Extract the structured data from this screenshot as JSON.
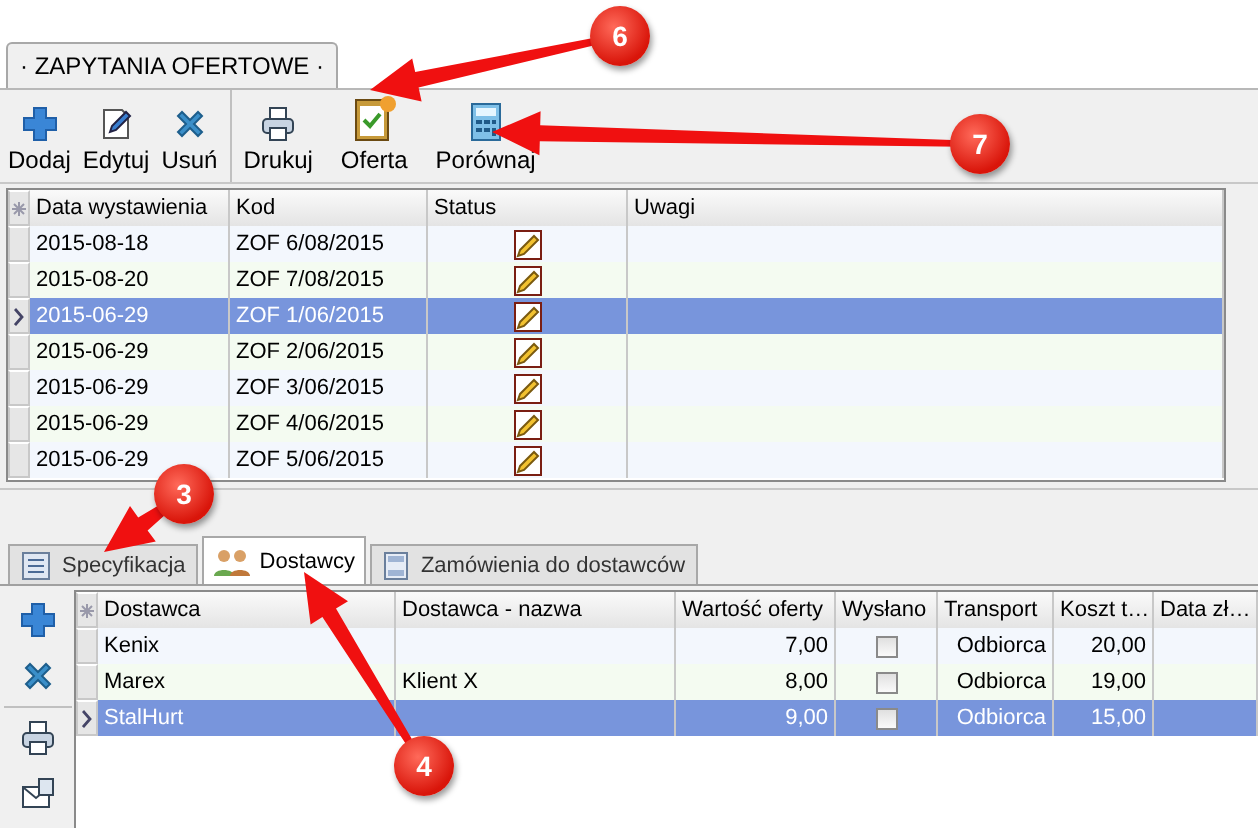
{
  "main_tab": {
    "label": "· ZAPYTANIA OFERTOWE ·"
  },
  "toolbar": {
    "groups": [
      [
        "Dodaj",
        "Edytuj",
        "Usuń"
      ],
      [
        "Drukuj",
        "Oferta",
        "Porównaj"
      ]
    ]
  },
  "offers_table": {
    "columns": [
      "Data wystawienia",
      "Kod",
      "Status",
      "Uwagi"
    ],
    "rows": [
      {
        "date": "2015-08-18",
        "code": "ZOF 6/08/2015",
        "selected": false
      },
      {
        "date": "2015-08-20",
        "code": "ZOF 7/08/2015",
        "selected": false
      },
      {
        "date": "2015-06-29",
        "code": "ZOF 1/06/2015",
        "selected": true
      },
      {
        "date": "2015-06-29",
        "code": "ZOF 2/06/2015",
        "selected": false
      },
      {
        "date": "2015-06-29",
        "code": "ZOF 3/06/2015",
        "selected": false
      },
      {
        "date": "2015-06-29",
        "code": "ZOF 4/06/2015",
        "selected": false
      },
      {
        "date": "2015-06-29",
        "code": "ZOF 5/06/2015",
        "selected": false
      }
    ]
  },
  "detail_tabs": [
    {
      "label": "Specyfikacja",
      "selected": false
    },
    {
      "label": "Dostawcy",
      "selected": true
    },
    {
      "label": "Zamówienia do dostawców",
      "selected": false
    }
  ],
  "suppliers_table": {
    "columns": [
      "Dostawca",
      "Dostawca - nazwa",
      "Wartość oferty",
      "Wysłano",
      "Transport",
      "Koszt t…",
      "Data zł…"
    ],
    "rows": [
      {
        "supplier": "Kenix",
        "name": "",
        "value": "7,00",
        "sent": false,
        "transport": "Odbiorca",
        "cost": "20,00",
        "selected": false
      },
      {
        "supplier": "Marex",
        "name": "Klient X",
        "value": "8,00",
        "sent": false,
        "transport": "Odbiorca",
        "cost": "19,00",
        "selected": false
      },
      {
        "supplier": "StalHurt",
        "name": "",
        "value": "9,00",
        "sent": false,
        "transport": "Odbiorca",
        "cost": "15,00",
        "selected": true
      }
    ]
  },
  "callouts": [
    {
      "number": "6"
    },
    {
      "number": "7"
    },
    {
      "number": "3"
    },
    {
      "number": "4"
    }
  ]
}
